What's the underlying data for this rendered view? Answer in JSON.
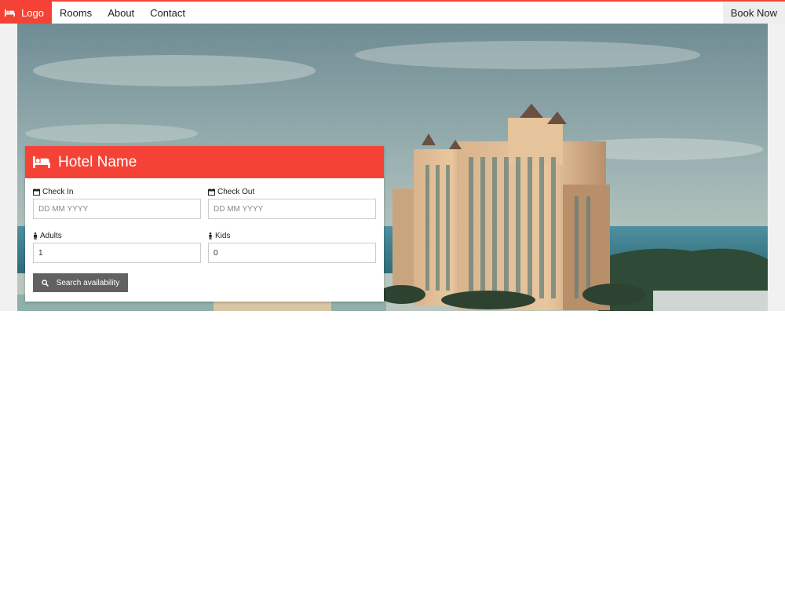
{
  "nav": {
    "logo_label": "Logo",
    "items": [
      {
        "label": "Rooms"
      },
      {
        "label": "About"
      },
      {
        "label": "Contact"
      }
    ],
    "book_label": "Book Now"
  },
  "booking": {
    "title": "Hotel Name",
    "check_in": {
      "label": "Check In",
      "placeholder": "DD MM YYYY"
    },
    "check_out": {
      "label": "Check Out",
      "placeholder": "DD MM YYYY"
    },
    "adults": {
      "label": "Adults",
      "value": "1"
    },
    "kids": {
      "label": "Kids",
      "value": "0"
    },
    "search_label": "Search availability"
  },
  "icons": {
    "bed": "bed-icon",
    "calendar": "calendar-icon",
    "male": "male-icon",
    "child": "child-icon",
    "search": "search-icon"
  },
  "colors": {
    "accent": "#f44336",
    "button": "#616161",
    "book_bg": "#eeeeee"
  }
}
